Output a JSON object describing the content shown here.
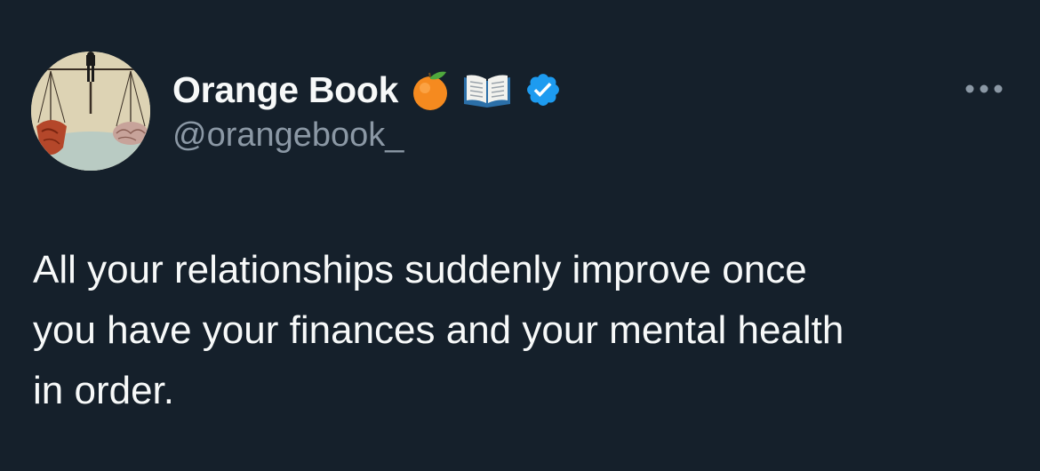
{
  "tweet": {
    "author": {
      "display_name": "Orange Book",
      "handle": "@orangebook_",
      "name_icons": [
        "orange-icon",
        "open-book-icon",
        "verified-badge-icon"
      ]
    },
    "text": "All your relationships suddenly improve once\nyou have your finances and your mental health\nin order."
  },
  "colors": {
    "background": "#15202b",
    "primary_text": "#f7f9f9",
    "secondary_text": "#8b98a5",
    "verified": "#1d9bf0"
  }
}
